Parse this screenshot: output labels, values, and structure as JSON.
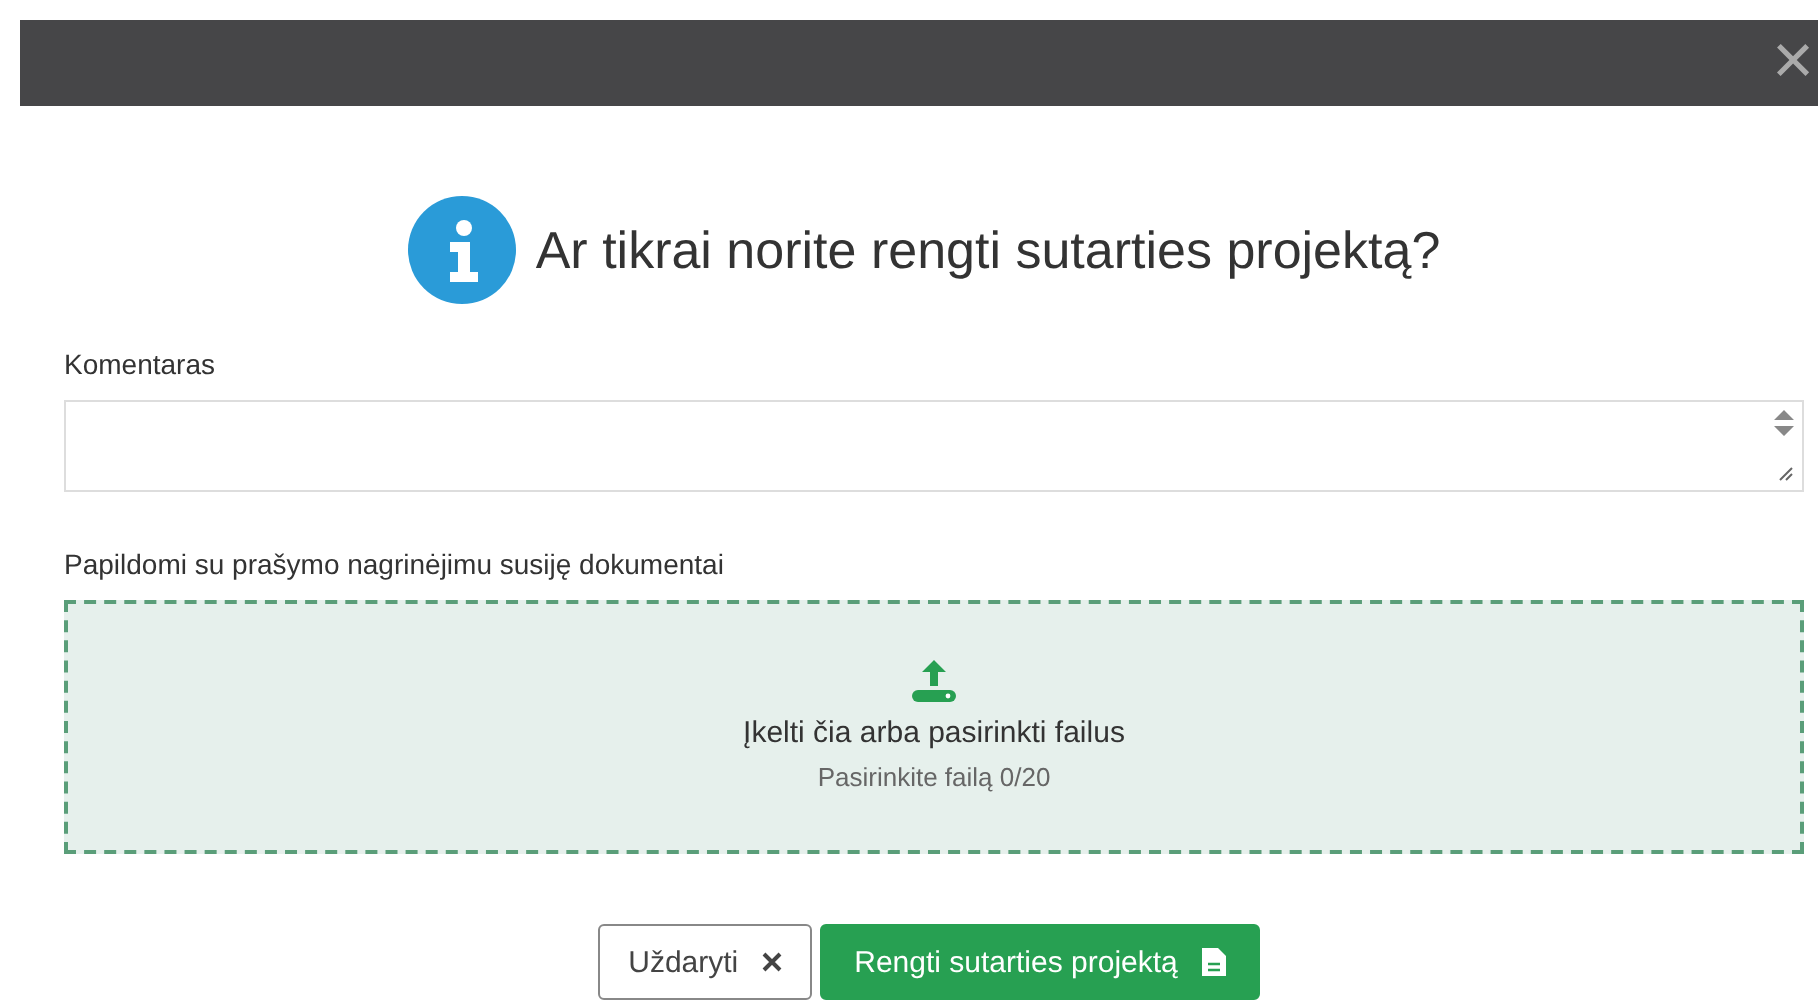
{
  "header": {
    "close": "×"
  },
  "title": "Ar tikrai norite rengti sutarties projektą?",
  "comment": {
    "label": "Komentaras"
  },
  "documents": {
    "label": "Papildomi su prašymo nagrinėjimu susiję dokumentai",
    "drop_text": "Įkelti čia arba pasirinkti failus",
    "hint": "Pasirinkite failą 0/20"
  },
  "buttons": [
    {
      "kind": "secondary",
      "label": "Uždaryti"
    },
    {
      "kind": "primary",
      "label": "Rengti sutarties projektą"
    }
  ]
}
